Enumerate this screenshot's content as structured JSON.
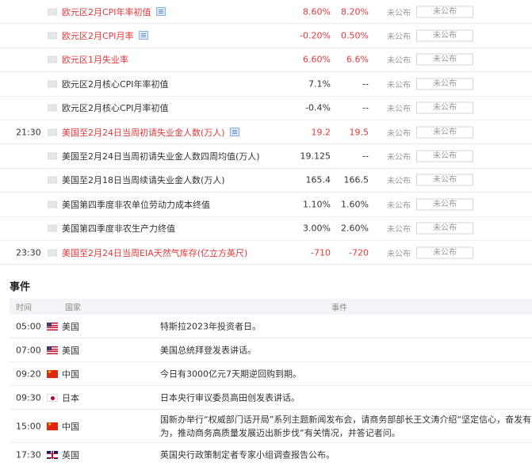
{
  "indicators": [
    {
      "time": "",
      "name": "欧元区2月CPI年率初值",
      "has_doc": true,
      "hot": true,
      "previous": "8.60%",
      "forecast": "8.20%",
      "actual_label": "未公布",
      "actual_box": "未公布"
    },
    {
      "time": "",
      "name": "欧元区2月CPI月率",
      "has_doc": true,
      "hot": true,
      "previous": "-0.20%",
      "forecast": "0.50%",
      "actual_label": "未公布",
      "actual_box": "未公布"
    },
    {
      "time": "",
      "name": "欧元区1月失业率",
      "has_doc": false,
      "hot": true,
      "previous": "6.60%",
      "forecast": "6.6%",
      "actual_label": "未公布",
      "actual_box": "未公布"
    },
    {
      "time": "",
      "name": "欧元区2月核心CPI年率初值",
      "has_doc": false,
      "hot": false,
      "previous": "7.1%",
      "forecast": "--",
      "actual_label": "未公布",
      "actual_box": "未公布"
    },
    {
      "time": "",
      "name": "欧元区2月核心CPI月率初值",
      "has_doc": false,
      "hot": false,
      "previous": "-0.4%",
      "forecast": "--",
      "actual_label": "未公布",
      "actual_box": "未公布"
    },
    {
      "time": "21:30",
      "name": "美国至2月24日当周初请失业金人数(万人)",
      "has_doc": true,
      "hot": true,
      "previous": "19.2",
      "forecast": "19.5",
      "actual_label": "未公布",
      "actual_box": "未公布"
    },
    {
      "time": "",
      "name": "美国至2月24日当周初请失业金人数四周均值(万人)",
      "has_doc": false,
      "hot": false,
      "previous": "19.125",
      "forecast": "--",
      "actual_label": "未公布",
      "actual_box": "未公布"
    },
    {
      "time": "",
      "name": "美国至2月18日当周续请失业金人数(万人)",
      "has_doc": false,
      "hot": false,
      "previous": "165.4",
      "forecast": "166.5",
      "actual_label": "未公布",
      "actual_box": "未公布"
    },
    {
      "time": "",
      "name": "美国第四季度非农单位劳动力成本终值",
      "has_doc": false,
      "hot": false,
      "previous": "1.10%",
      "forecast": "1.60%",
      "actual_label": "未公布",
      "actual_box": "未公布"
    },
    {
      "time": "",
      "name": "美国第四季度非农生产力终值",
      "has_doc": false,
      "hot": false,
      "previous": "3.00%",
      "forecast": "2.60%",
      "actual_label": "未公布",
      "actual_box": "未公布"
    },
    {
      "time": "23:30",
      "name": "美国至2月24日当周EIA天然气库存(亿立方英尺)",
      "has_doc": false,
      "hot": true,
      "previous": "-710",
      "forecast": "-720",
      "actual_label": "未公布",
      "actual_box": "未公布"
    }
  ],
  "events": {
    "title": "事件",
    "headers": {
      "time": "时间",
      "country": "国家",
      "event": "事件"
    },
    "rows": [
      {
        "time": "05:00",
        "flag": "us",
        "country": "美国",
        "desc": "特斯拉2023年投资者日。"
      },
      {
        "time": "07:00",
        "flag": "us",
        "country": "美国",
        "desc": "美国总统拜登发表讲话。"
      },
      {
        "time": "09:20",
        "flag": "cn",
        "country": "中国",
        "desc": "今日有3000亿元7天期逆回购到期。"
      },
      {
        "time": "09:30",
        "flag": "jp",
        "country": "日本",
        "desc": "日本央行审议委员高田创发表讲话。"
      },
      {
        "time": "15:00",
        "flag": "cn",
        "country": "中国",
        "desc": "国新办举行“权威部门话开局”系列主题新闻发布会，请商务部部长王文涛介绍“坚定信心，奋发有为，推动商务高质量发展迈出新步伐”有关情况，并答记者问。"
      },
      {
        "time": "17:30",
        "flag": "uk",
        "country": "英国",
        "desc": "英国央行政策制定者专家小组调查报告公布。"
      }
    ]
  }
}
